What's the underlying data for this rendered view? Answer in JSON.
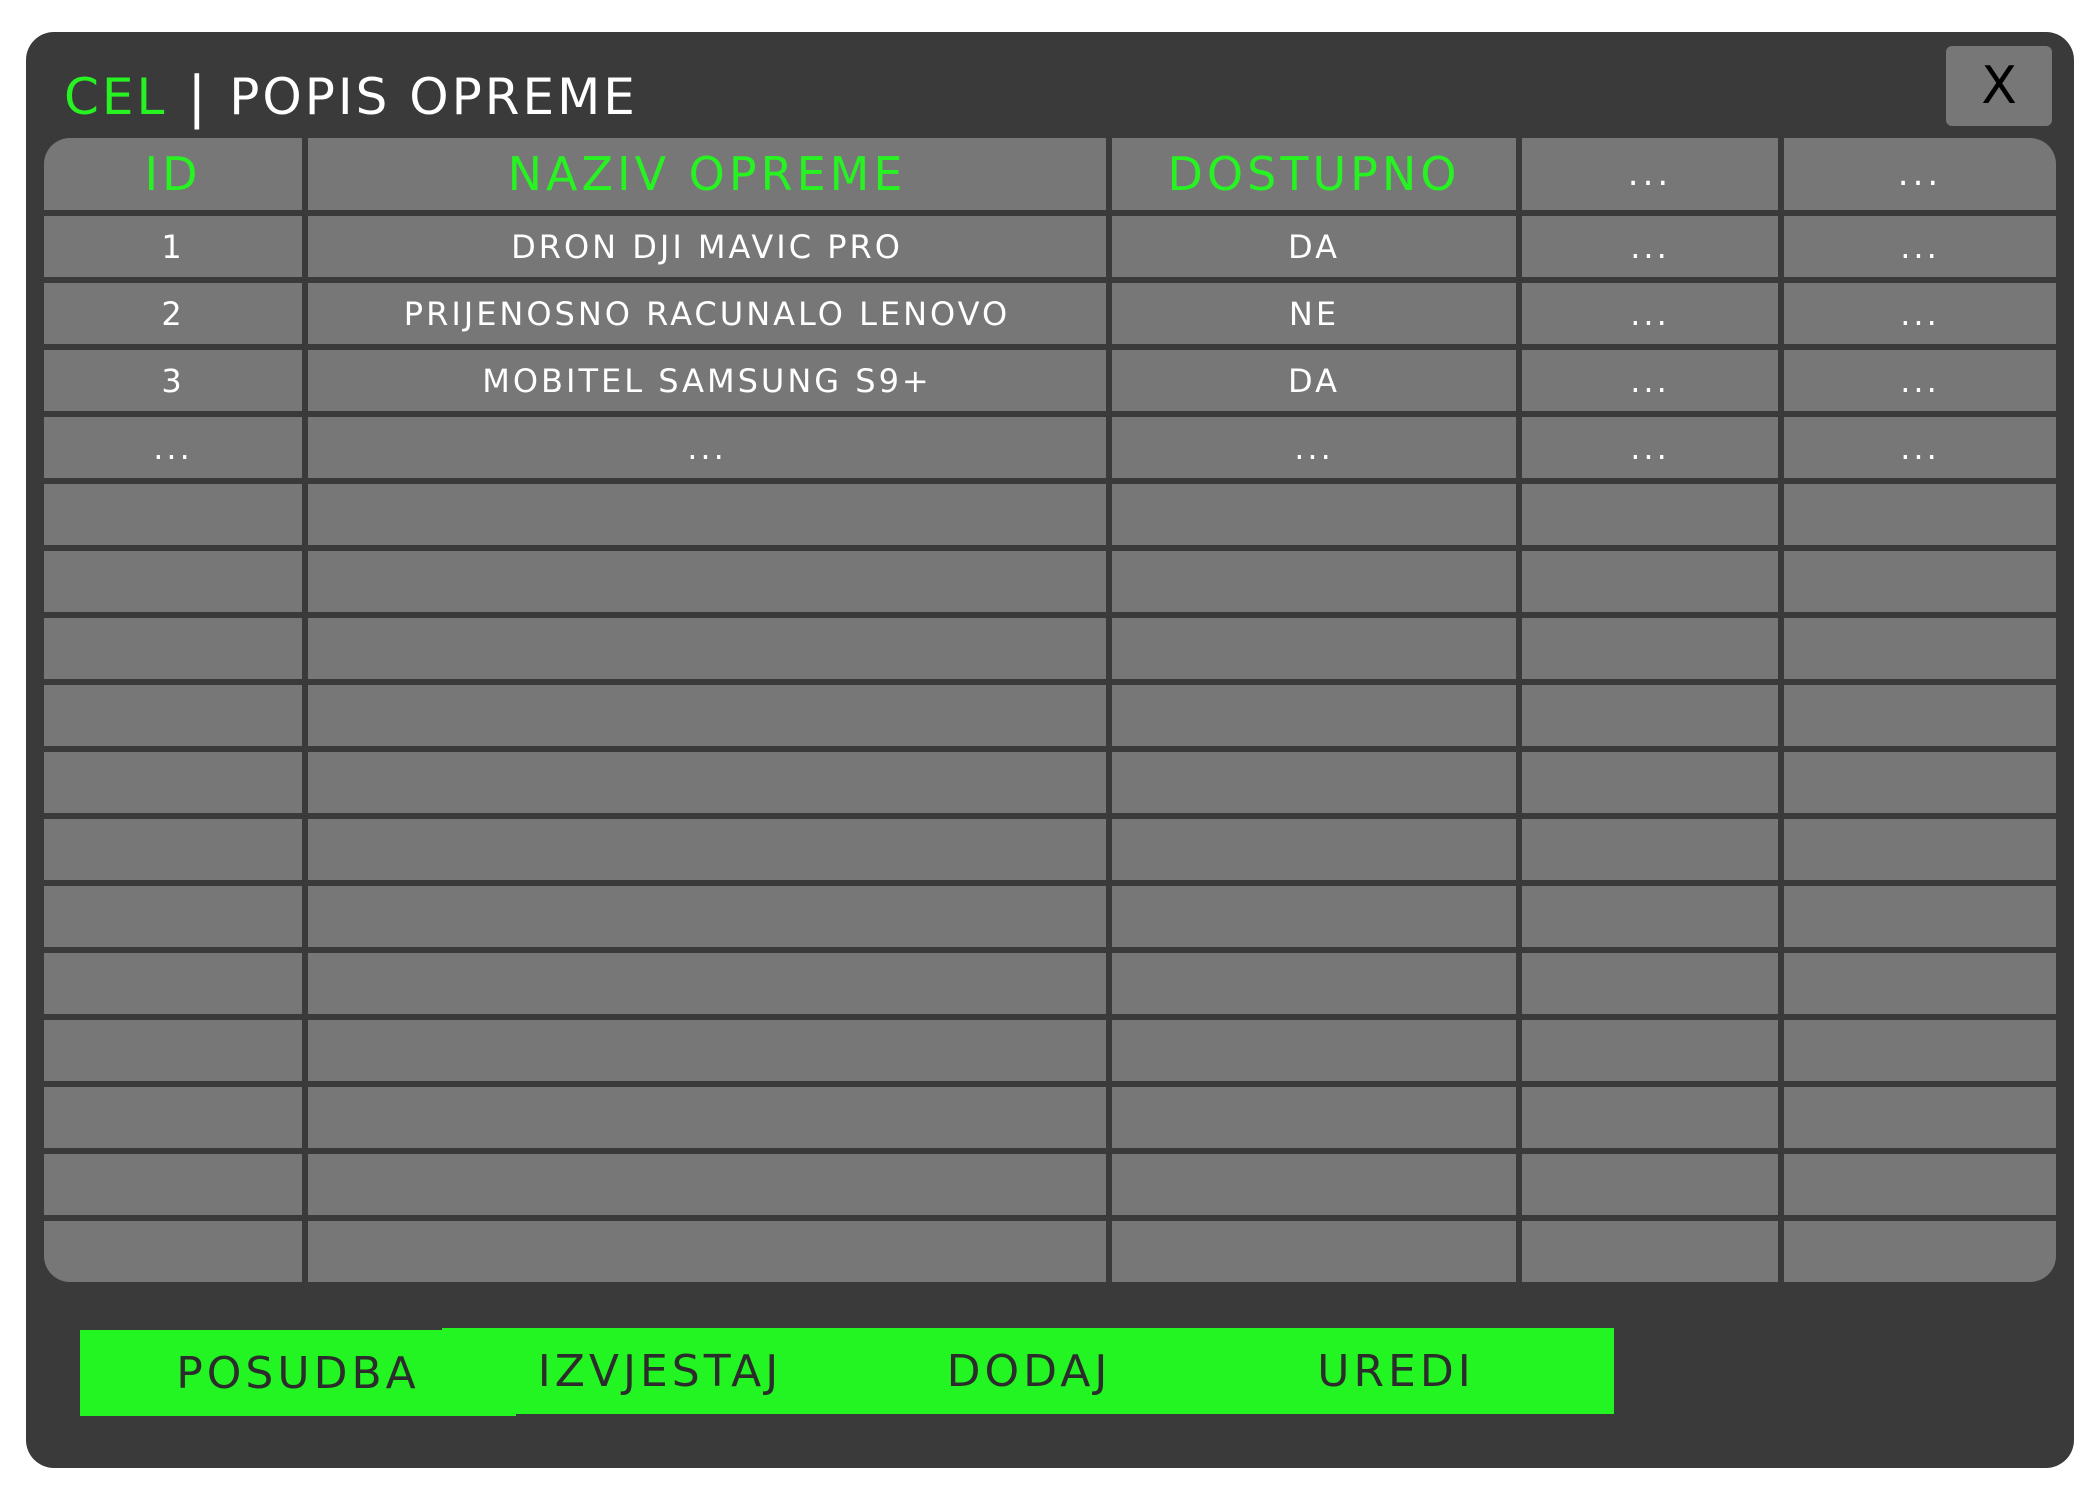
{
  "window": {
    "brand": "CEL",
    "separator": "|",
    "title": "POPIS OPREME",
    "close_label": "X"
  },
  "table": {
    "columns": [
      "ID",
      "NAZIV OPREME",
      "DOSTUPNO",
      "...",
      "..."
    ],
    "rows": [
      [
        "1",
        "DRON DJI MAVIC PRO",
        "DA",
        "...",
        "..."
      ],
      [
        "2",
        "PRIJENOSNO RACUNALO LENOVO",
        "NE",
        "...",
        "..."
      ],
      [
        "3",
        "MOBITEL SAMSUNG S9+",
        "DA",
        "...",
        "..."
      ],
      [
        "...",
        "...",
        "...",
        "...",
        "..."
      ],
      [
        "",
        "",
        "",
        "",
        ""
      ],
      [
        "",
        "",
        "",
        "",
        ""
      ],
      [
        "",
        "",
        "",
        "",
        ""
      ],
      [
        "",
        "",
        "",
        "",
        ""
      ],
      [
        "",
        "",
        "",
        "",
        ""
      ],
      [
        "",
        "",
        "",
        "",
        ""
      ],
      [
        "",
        "",
        "",
        "",
        ""
      ],
      [
        "",
        "",
        "",
        "",
        ""
      ],
      [
        "",
        "",
        "",
        "",
        ""
      ],
      [
        "",
        "",
        "",
        "",
        ""
      ],
      [
        "",
        "",
        "",
        "",
        ""
      ],
      [
        "",
        "",
        "",
        "",
        ""
      ]
    ]
  },
  "buttons": {
    "posudba": "POSUDBA",
    "izvjestaj": "IZVJESTAJ",
    "dodaj": "DODAJ",
    "uredi": "UREDI"
  },
  "colors": {
    "accent": "#27f322",
    "window_bg": "#3a3a3a",
    "cell_bg": "#777777"
  }
}
